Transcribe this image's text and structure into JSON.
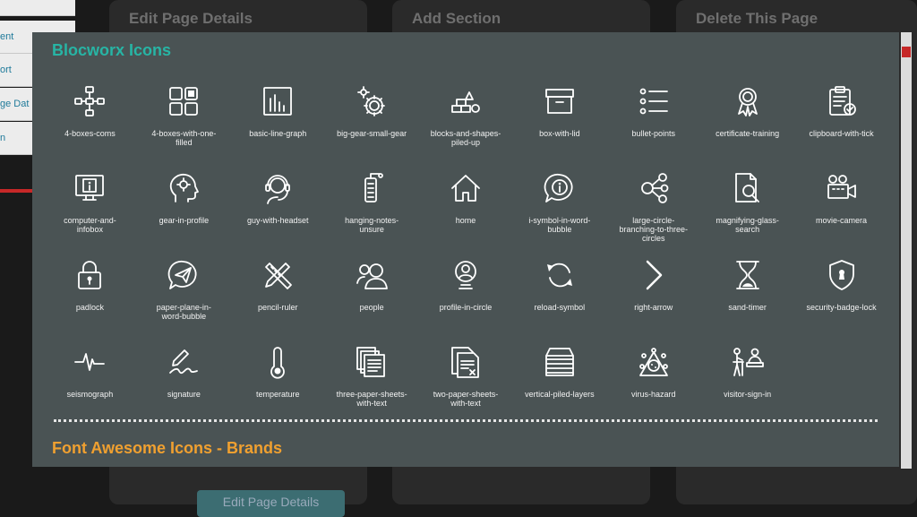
{
  "background": {
    "sidebar_items": [
      "ent",
      "ort",
      "ge Dat",
      "n"
    ],
    "cards": [
      "Edit Page Details",
      "Add Section",
      "Delete This Page"
    ],
    "bottom_button": "Edit Page Details"
  },
  "modal": {
    "title": "Blocworx Icons",
    "icons": [
      {
        "label": "4-boxes-coms",
        "icon": "4-boxes-coms-icon"
      },
      {
        "label": "4-boxes-with-one-filled",
        "icon": "4-boxes-with-one-filled-icon"
      },
      {
        "label": "basic-line-graph",
        "icon": "basic-line-graph-icon"
      },
      {
        "label": "big-gear-small-gear",
        "icon": "big-gear-small-gear-icon"
      },
      {
        "label": "blocks-and-shapes-piled-up",
        "icon": "blocks-and-shapes-piled-up-icon"
      },
      {
        "label": "box-with-lid",
        "icon": "box-with-lid-icon"
      },
      {
        "label": "bullet-points",
        "icon": "bullet-points-icon"
      },
      {
        "label": "certificate-training",
        "icon": "certificate-training-icon"
      },
      {
        "label": "clipboard-with-tick",
        "icon": "clipboard-with-tick-icon"
      },
      {
        "label": "computer-and-infobox",
        "icon": "computer-and-infobox-icon"
      },
      {
        "label": "gear-in-profile",
        "icon": "gear-in-profile-icon"
      },
      {
        "label": "guy-with-headset",
        "icon": "guy-with-headset-icon"
      },
      {
        "label": "hanging-notes-unsure",
        "icon": "hanging-notes-unsure-icon"
      },
      {
        "label": "home",
        "icon": "home-icon"
      },
      {
        "label": "i-symbol-in-word-bubble",
        "icon": "i-symbol-in-word-bubble-icon"
      },
      {
        "label": "large-circle-branching-to-three-circles",
        "icon": "large-circle-branching-to-three-circles-icon"
      },
      {
        "label": "magnifying-glass-search",
        "icon": "magnifying-glass-search-icon"
      },
      {
        "label": "movie-camera",
        "icon": "movie-camera-icon"
      },
      {
        "label": "padlock",
        "icon": "padlock-icon"
      },
      {
        "label": "paper-plane-in-word-bubble",
        "icon": "paper-plane-in-word-bubble-icon"
      },
      {
        "label": "pencil-ruler",
        "icon": "pencil-ruler-icon"
      },
      {
        "label": "people",
        "icon": "people-icon"
      },
      {
        "label": "profile-in-circle",
        "icon": "profile-in-circle-icon"
      },
      {
        "label": "reload-symbol",
        "icon": "reload-symbol-icon"
      },
      {
        "label": "right-arrow",
        "icon": "right-arrow-icon"
      },
      {
        "label": "sand-timer",
        "icon": "sand-timer-icon"
      },
      {
        "label": "security-badge-lock",
        "icon": "security-badge-lock-icon"
      },
      {
        "label": "seismograph",
        "icon": "seismograph-icon"
      },
      {
        "label": "signature",
        "icon": "signature-icon"
      },
      {
        "label": "temperature",
        "icon": "temperature-icon"
      },
      {
        "label": "three-paper-sheets-with-text",
        "icon": "three-paper-sheets-with-text-icon"
      },
      {
        "label": "two-paper-sheets-with-text",
        "icon": "two-paper-sheets-with-text-icon"
      },
      {
        "label": "vertical-piled-layers",
        "icon": "vertical-piled-layers-icon"
      },
      {
        "label": "virus-hazard",
        "icon": "virus-hazard-icon"
      },
      {
        "label": "visitor-sign-in",
        "icon": "visitor-sign-in-icon"
      }
    ],
    "next_section_title": "Font Awesome Icons - Brands"
  },
  "colors": {
    "modal_bg": "#4a5354",
    "title_teal": "#27b5a5",
    "section_orange": "#f0a030",
    "scrollbar_accent": "#c62828"
  }
}
